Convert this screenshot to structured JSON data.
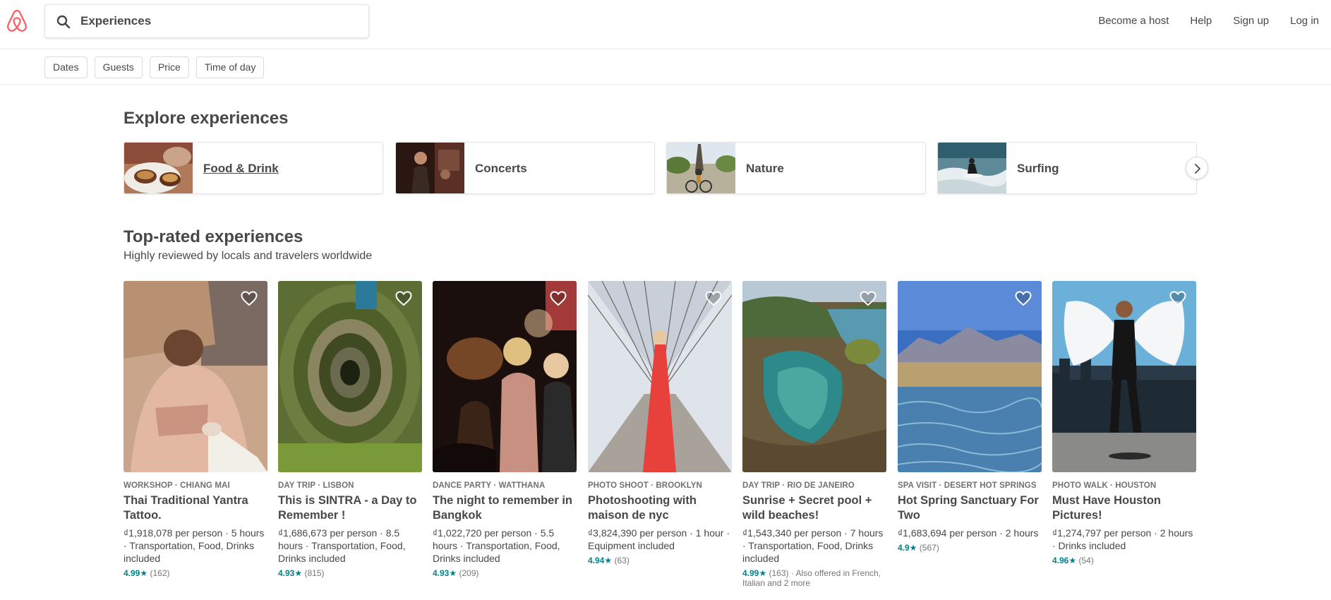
{
  "header": {
    "search_value": "Experiences",
    "nav": [
      "Become a host",
      "Help",
      "Sign up",
      "Log in"
    ]
  },
  "filters": [
    "Dates",
    "Guests",
    "Price",
    "Time of day"
  ],
  "explore": {
    "title": "Explore experiences",
    "categories": [
      {
        "label": "Food & Drink"
      },
      {
        "label": "Concerts"
      },
      {
        "label": "Nature"
      },
      {
        "label": "Surfing"
      }
    ]
  },
  "top_rated": {
    "title": "Top-rated experiences",
    "subtitle": "Highly reviewed by locals and travelers worldwide",
    "cards": [
      {
        "kicker": "WORKSHOP · CHIANG MAI",
        "title": "Thai Traditional Yantra Tattoo.",
        "meta": "₫1,918,078 per person · 5 hours · Transportation, Food, Drinks included",
        "score": "4.99★",
        "count": "(162)",
        "also": ""
      },
      {
        "kicker": "DAY TRIP · LISBON",
        "title": "This is SINTRA - a Day to Remember !",
        "meta": "₫1,686,673 per person · 8.5 hours · Transportation, Food, Drinks included",
        "score": "4.93★",
        "count": "(815)",
        "also": ""
      },
      {
        "kicker": "DANCE PARTY · WATTHANA",
        "title": "The night to remember in Bangkok",
        "meta": "₫1,022,720 per person · 5.5 hours · Transportation, Food, Drinks included",
        "score": "4.93★",
        "count": "(209)",
        "also": ""
      },
      {
        "kicker": "PHOTO SHOOT · BROOKLYN",
        "title": "Photoshooting with maison de nyc",
        "meta": "₫3,824,390 per person · 1 hour · Equipment included",
        "score": "4.94★",
        "count": "(63)",
        "also": ""
      },
      {
        "kicker": "DAY TRIP · RIO DE JANEIRO",
        "title": "Sunrise + Secret pool + wild beaches!",
        "meta": "₫1,543,340 per person · 7 hours · Transportation, Food, Drinks included",
        "score": "4.99★",
        "count": "(163)",
        "also": "· Also offered in French, Italian and 2 more"
      },
      {
        "kicker": "SPA VISIT · DESERT HOT SPRINGS",
        "title": "Hot Spring Sanctuary For Two",
        "meta": "₫1,683,694 per person · 2 hours",
        "score": "4.9★",
        "count": "(567)",
        "also": ""
      },
      {
        "kicker": "PHOTO WALK · HOUSTON",
        "title": "Must Have Houston Pictures!",
        "meta": "₫1,274,797 per person · 2 hours · Drinks included",
        "score": "4.96★",
        "count": "(54)",
        "also": ""
      }
    ]
  }
}
